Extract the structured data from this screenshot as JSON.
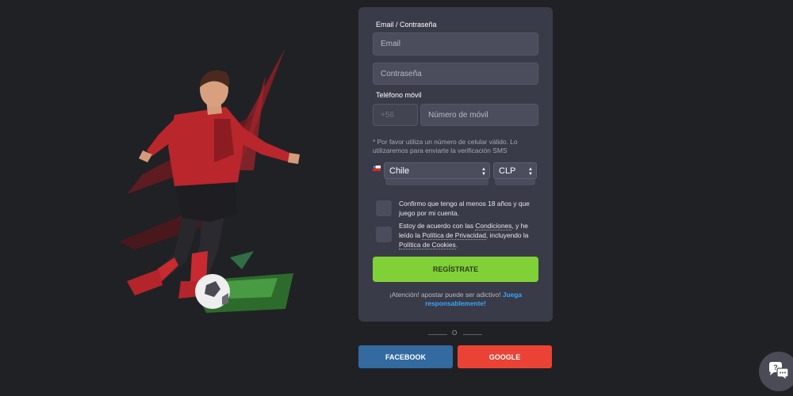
{
  "form": {
    "email_section_label": "Email / Contraseña",
    "email_placeholder": "Email",
    "password_placeholder": "Contraseña",
    "phone_section_label": "Teléfono móvil",
    "phone_prefix": "+56",
    "phone_placeholder": "Número de móvil",
    "phone_note": "* Por favor utiliza un número de celular válido. Lo utilizaremos para enviarte la verificación SMS",
    "country_value": "Chile",
    "currency_value": "CLP",
    "age_confirm_text": "Confirmo que tengo al menos 18 años y que juego por mi cuenta.",
    "terms_text": {
      "part1": "Estoy de acuerdo con las ",
      "link1": "Condiciones",
      "part2": ", y he leído la ",
      "link2": "Política de Privacidad",
      "part3": ", incluyendo la ",
      "link3": "Política de Cookies",
      "part4": "."
    },
    "register_label": "REGÍSTRATE",
    "warning_text": "¡Atención! apostar puede ser adictivo! ",
    "warning_link": "Juega responsablemente!"
  },
  "divider_text": "O",
  "social": {
    "facebook_label": "FACEBOOK",
    "google_label": "GOOGLE"
  },
  "colors": {
    "background": "#202125",
    "card": "#3a3b48",
    "input": "#4b4c5c",
    "register": "#7fd137",
    "facebook": "#336aa0",
    "google": "#ea4335",
    "link": "#35a7ff"
  },
  "icons": {
    "hero": "soccer-player-illustration",
    "flag": "chile-flag-icon",
    "chat": "chat-bubbles-icon"
  }
}
